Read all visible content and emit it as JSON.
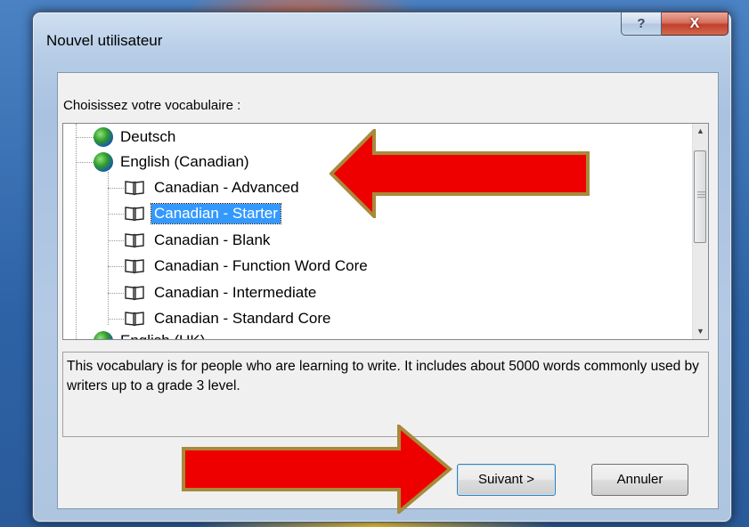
{
  "window": {
    "title": "Nouvel utilisateur",
    "help_button": "?",
    "close_button": "X"
  },
  "vocab_label": "Choisissez votre vocabulaire :",
  "tree": {
    "items": [
      {
        "label": "Deutsch",
        "type": "globe",
        "level": 0
      },
      {
        "label": "English (Canadian)",
        "type": "globe",
        "level": 0
      },
      {
        "label": "Canadian - Advanced",
        "type": "book",
        "level": 1
      },
      {
        "label": "Canadian - Starter",
        "type": "book",
        "level": 1,
        "selected": true
      },
      {
        "label": "Canadian - Blank",
        "type": "book",
        "level": 1
      },
      {
        "label": "Canadian - Function Word Core",
        "type": "book",
        "level": 1
      },
      {
        "label": "Canadian - Intermediate",
        "type": "book",
        "level": 1
      },
      {
        "label": "Canadian - Standard Core",
        "type": "book",
        "level": 1
      },
      {
        "label": "English (UK)",
        "type": "globe",
        "level": 0
      }
    ]
  },
  "description": "This vocabulary is for people who are learning to write.  It includes about 5000 words commonly used by writers up to a grade 3 level.",
  "buttons": {
    "next": "Suivant >",
    "cancel": "Annuler"
  },
  "colors": {
    "selection": "#3399ff",
    "arrow_fill": "#ee0000",
    "arrow_outline": "#a88a3c"
  }
}
